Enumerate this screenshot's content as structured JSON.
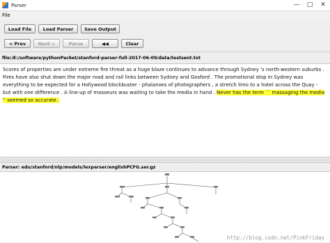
{
  "window": {
    "title": "Parser",
    "controls": [
      "—",
      "□",
      "✕"
    ]
  },
  "menu": {
    "file": "File"
  },
  "toolbar1": {
    "load_file": "Load File",
    "load_parser": "Load Parser",
    "save_output": "Save Output"
  },
  "toolbar2": {
    "prev": "< Prev",
    "next": "Next >",
    "parse": "Parse",
    "parse_state": "disabled",
    "next_state": "disabled",
    "clear": "Clear"
  },
  "file_label": "file:/E:/software/pythonPacket/stanford-parser-full-2017-06-09/data/testsent.txt",
  "text": {
    "plain": "Scores of properties are under extreme fire threat as a huge blaze continues to advance through Sydney 's north-western suburbs . Fires have also shut down the major road and rail links between Sydney and Gosford . The promotional stop in Sydney was everything to be expected for a Hollywood blockbuster - phalanxes of photographers , a stretch limo to a hotel across the Quay - but with one difference . A line-up of masseurs was waiting to take the media in hand . ",
    "highlighted": "Never has the term `` massaging the media '' seemed so accurate .",
    "highlight_color": "#ffff33"
  },
  "parser_label": "Parser: edu/stanford/nlp/models/lexparser/englishPCFG.ser.gz",
  "watermark": "http://blog.csdn.net/PinkFriday"
}
